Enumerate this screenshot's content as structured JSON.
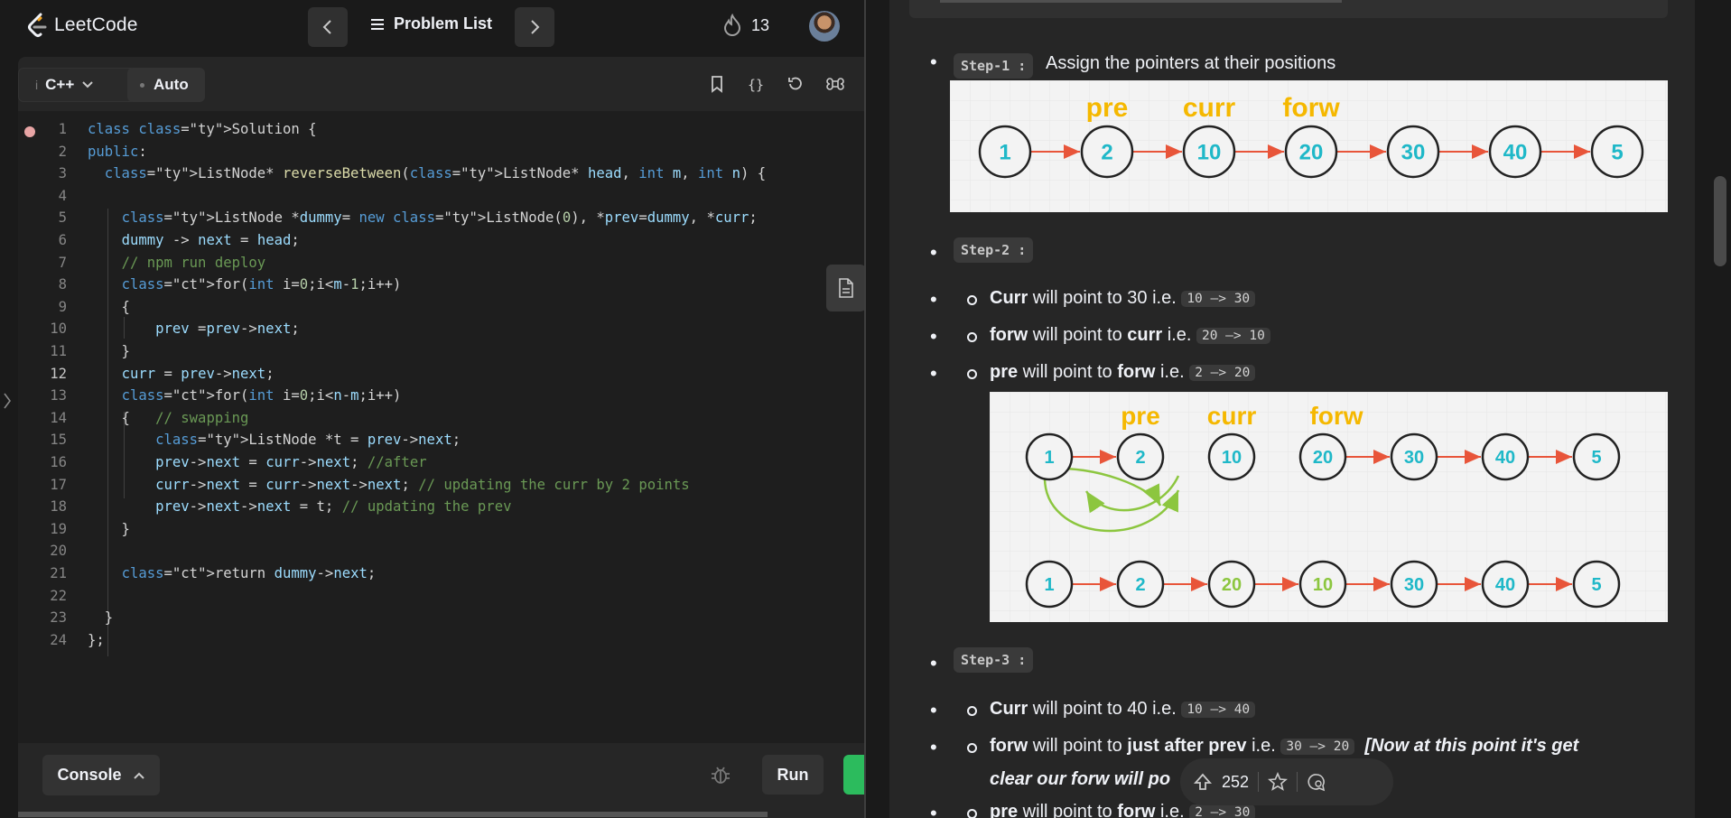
{
  "header": {
    "logo_text": "LeetCode",
    "problem_list_label": "Problem List",
    "streak_count": "13"
  },
  "editor": {
    "language": "C++",
    "mode": "Auto",
    "active_line": 12,
    "line_numbers": [
      "1",
      "2",
      "3",
      "4",
      "5",
      "6",
      "7",
      "8",
      "9",
      "10",
      "11",
      "12",
      "13",
      "14",
      "15",
      "16",
      "17",
      "18",
      "19",
      "20",
      "21",
      "22",
      "23",
      "24"
    ],
    "code_lines": [
      "class Solution {",
      "public:",
      "  ListNode* reverseBetween(ListNode* head, int m, int n) {",
      "",
      "    ListNode *dummy= new ListNode(0), *prev=dummy, *curr;",
      "    dummy -> next = head;",
      "    // npm run deploy",
      "    for(int i=0;i<m-1;i++)",
      "    {",
      "        prev =prev->next;",
      "    }",
      "    curr = prev->next;",
      "    for(int i=0;i<n-m;i++)",
      "    {   // swapping",
      "        ListNode *t = prev->next;",
      "        prev->next = curr->next; //after",
      "        curr->next = curr->next->next; // updating the curr by 2 points",
      "        prev->next->next = t; // updating the prev",
      "    }",
      "",
      "    return dummy->next;",
      "",
      "  }",
      "};"
    ],
    "console_label": "Console",
    "run_label": "Run"
  },
  "solution": {
    "steps": [
      {
        "tag": "Step-1 :",
        "text": "Assign the pointers at their positions"
      },
      {
        "tag": "Step-2 :"
      },
      {
        "tag": "Step-3 :"
      }
    ],
    "step2_items": [
      {
        "bold1": "Curr",
        "mid": " will point to 30 i.e. ",
        "chip": "10 —> 30"
      },
      {
        "bold1": "forw",
        "mid": " will point to ",
        "bold2": "curr",
        "tail": " i.e. ",
        "chip": "20 —> 10"
      },
      {
        "bold1": "pre",
        "mid": " will point to ",
        "bold2": "forw",
        "tail": " i.e. ",
        "chip": "2 —> 20"
      }
    ],
    "step3_items": [
      {
        "bold1": "Curr",
        "mid": " will point to 40 i.e. ",
        "chip": "10 —> 40"
      },
      {
        "bold1": "forw",
        "mid": " will point to ",
        "bold2": "just after prev",
        "tail": " i.e. ",
        "chip": "30 —> 20",
        "note": "[Now at this point it's get",
        "note2": "clear our forw will po"
      },
      {
        "bold1": "pre",
        "mid": " will point to ",
        "bold2": "forw",
        "tail": " i.e. ",
        "chip": "2 —> 30"
      }
    ],
    "diagram1": {
      "labels": [
        "pre",
        "curr",
        "forw"
      ],
      "nodes": [
        "1",
        "2",
        "10",
        "20",
        "30",
        "40",
        "5"
      ]
    },
    "diagram2": {
      "labels": [
        "pre",
        "curr",
        "forw"
      ],
      "row1": [
        "1",
        "2",
        "10",
        "20",
        "30",
        "40",
        "5"
      ],
      "row2": [
        "1",
        "2",
        "20",
        "10",
        "30",
        "40",
        "5"
      ]
    },
    "votes": "252"
  },
  "colors": {
    "accent_yellow": "#f5b800",
    "node_teal": "#1fb8c8",
    "node_green": "#8cc63f",
    "arrow_red": "#e8553a",
    "curve_green": "#8cc63f",
    "submit_green": "#2cbb5d"
  }
}
